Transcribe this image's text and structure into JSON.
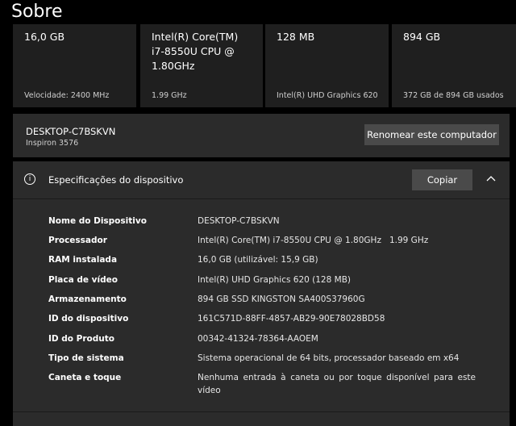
{
  "title": "Sobre",
  "cards": [
    {
      "main": "16,0 GB",
      "sub": "Velocidade: 2400 MHz"
    },
    {
      "main": "Intel(R) Core(TM)\ni7-8550U CPU @\n1.80GHz",
      "sub": "1.99 GHz"
    },
    {
      "main": "128 MB",
      "sub": "Intel(R) UHD Graphics 620"
    },
    {
      "main": "894 GB",
      "sub": "372 GB de 894 GB usados"
    }
  ],
  "device": {
    "name": "DESKTOP-C7BSKVN",
    "model": "Inspiron 3576",
    "rename_label": "Renomear este computador"
  },
  "specs": {
    "header": "Especificações do dispositivo",
    "copy_label": "Copiar",
    "rows": [
      {
        "key": "Nome do Dispositivo",
        "value": "DESKTOP-C7BSKVN"
      },
      {
        "key": "Processador",
        "value": "Intel(R) Core(TM) i7-8550U CPU @ 1.80GHz   1.99 GHz"
      },
      {
        "key": "RAM instalada",
        "value": "16,0 GB (utilizável: 15,9 GB)"
      },
      {
        "key": "Placa de vídeo",
        "value": "Intel(R) UHD Graphics 620 (128 MB)"
      },
      {
        "key": "Armazenamento",
        "value": "894 GB SSD KINGSTON SA400S37960G"
      },
      {
        "key": "ID do dispositivo",
        "value": "161C571D-88FF-4857-AB29-90E78028BD58"
      },
      {
        "key": "ID do Produto",
        "value": "00342-41324-78364-AAOEM"
      },
      {
        "key": "Tipo de sistema",
        "value": "Sistema operacional de 64 bits, processador baseado em x64"
      },
      {
        "key": "Caneta e toque",
        "value": "Nenhuma entrada à caneta ou por toque disponível para este vídeo"
      }
    ]
  }
}
